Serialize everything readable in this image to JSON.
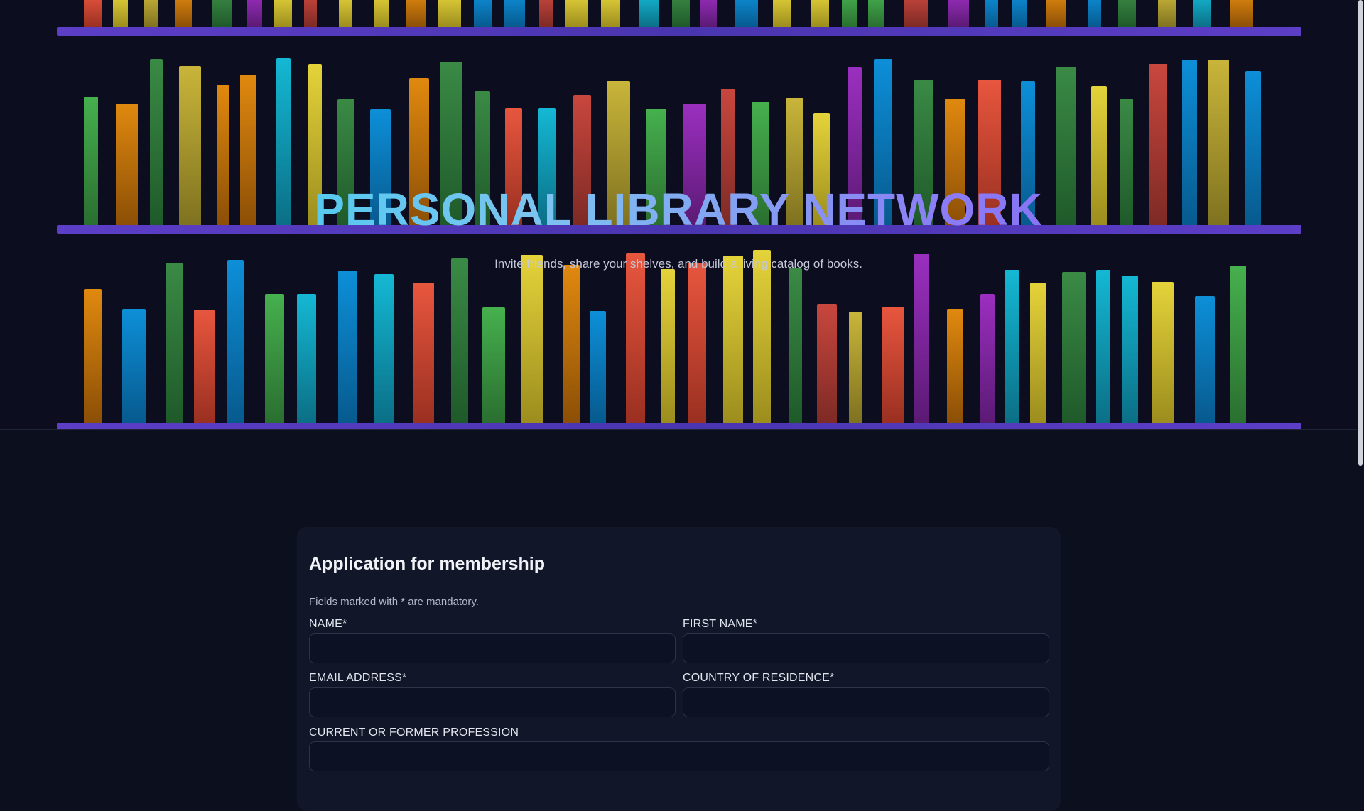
{
  "hero": {
    "title": "PERSONAL LIBRARY NETWORK",
    "subtitle": "Invite friends, share your shelves, and build a living catalog of books."
  },
  "form": {
    "title": "Application for membership",
    "note": "Fields marked with * are mandatory.",
    "fields": [
      {
        "label": "NAME*",
        "value": "",
        "placeholder": ""
      },
      {
        "label": "FIRST NAME*",
        "value": "",
        "placeholder": ""
      },
      {
        "label": "EMAIL ADDRESS*",
        "value": "",
        "placeholder": ""
      },
      {
        "label": "COUNTRY OF RESIDENCE*",
        "value": "",
        "placeholder": ""
      },
      {
        "label": "CURRENT OR FORMER PROFESSION",
        "value": "",
        "placeholder": ""
      }
    ]
  },
  "colors": {
    "background": "#0b0f1e",
    "card": "#111628",
    "shelf_plank": "#5c3ec7",
    "title_gradient_start": "#22d3ee",
    "title_gradient_end": "#7b5cf0"
  }
}
